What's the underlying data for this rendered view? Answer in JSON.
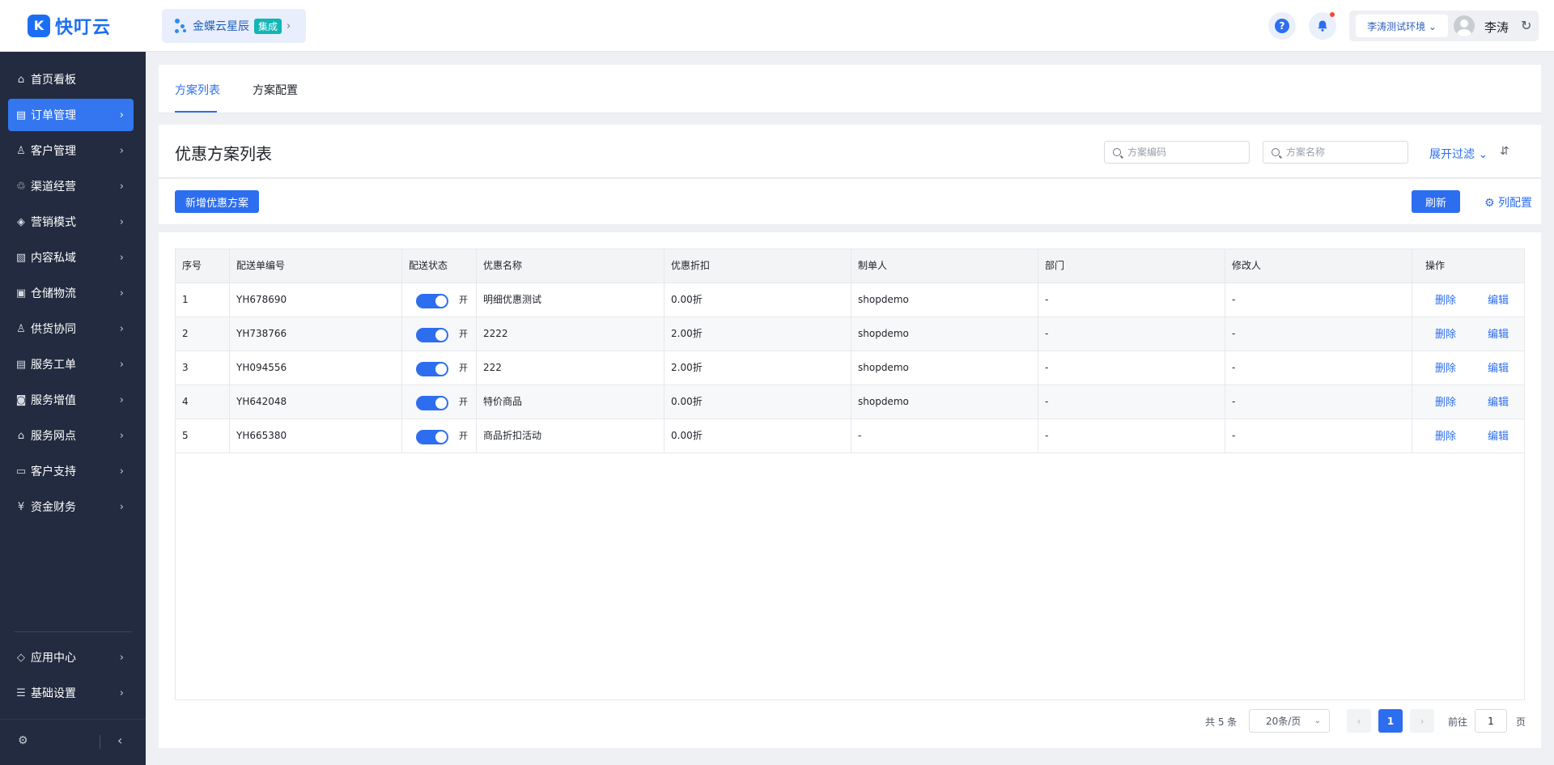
{
  "brand": {
    "logo_text": "快叮云",
    "logo_mark": "K"
  },
  "integration": {
    "label": "金蝶云星辰",
    "tag": "集成",
    "arrow": "›"
  },
  "topbar": {
    "help_icon": "question-circle-icon",
    "bell_icon": "bell-icon",
    "environment": "李涛测试环境 ⌄",
    "user_name": "李涛",
    "refresh_glyph": "↻"
  },
  "sidebar": {
    "items": [
      {
        "label": "首页看板",
        "icon": "⌂",
        "chevron": ""
      },
      {
        "label": "订单管理",
        "icon": "▤",
        "chevron": "›"
      },
      {
        "label": "客户管理",
        "icon": "♙",
        "chevron": "›"
      },
      {
        "label": "渠道经营",
        "icon": "♲",
        "chevron": "›"
      },
      {
        "label": "营销模式",
        "icon": "◈",
        "chevron": "›"
      },
      {
        "label": "内容私域",
        "icon": "▧",
        "chevron": "›"
      },
      {
        "label": "仓储物流",
        "icon": "▣",
        "chevron": "›"
      },
      {
        "label": "供货协同",
        "icon": "♙",
        "chevron": "›"
      },
      {
        "label": "服务工单",
        "icon": "▤",
        "chevron": "›"
      },
      {
        "label": "服务增值",
        "icon": "◙",
        "chevron": "›"
      },
      {
        "label": "服务网点",
        "icon": "⌂",
        "chevron": "›"
      },
      {
        "label": "客户支持",
        "icon": "▭",
        "chevron": "›"
      },
      {
        "label": "资金财务",
        "icon": "¥",
        "chevron": "›"
      }
    ],
    "bottom_items": [
      {
        "label": "应用中心",
        "icon": "◇",
        "chevron": "›"
      },
      {
        "label": "基础设置",
        "icon": "☰",
        "chevron": "›"
      }
    ],
    "active_index": 1,
    "footer": {
      "gear_glyph": "⚙",
      "collapse_glyph": "‹"
    }
  },
  "tabs": [
    {
      "label": "方案列表"
    },
    {
      "label": "方案配置"
    }
  ],
  "header": {
    "title": "优惠方案列表",
    "search1_placeholder": "方案编码",
    "search2_placeholder": "方案名称",
    "expand_filter": "展开过滤 ⌄",
    "sort_glyph": "⇵"
  },
  "actions": {
    "add_button": "新增优惠方案",
    "refresh_button": "刷新",
    "column_config": "⚙ 列配置"
  },
  "table": {
    "columns": [
      "序号",
      "配送单编号",
      "配送状态",
      "优惠名称",
      "优惠折扣",
      "制单人",
      "部门",
      "修改人",
      "操作"
    ],
    "rows": [
      {
        "index": "1",
        "code": "YH678690",
        "status_on": true,
        "status_label": "开",
        "name": "明细优惠测试",
        "discount": "0.00折",
        "creator": "shopdemo",
        "dept": "-",
        "modifier": "-"
      },
      {
        "index": "2",
        "code": "YH738766",
        "status_on": true,
        "status_label": "开",
        "name": "2222",
        "discount": "2.00折",
        "creator": "shopdemo",
        "dept": "-",
        "modifier": "-"
      },
      {
        "index": "3",
        "code": "YH094556",
        "status_on": true,
        "status_label": "开",
        "name": "222",
        "discount": "2.00折",
        "creator": "shopdemo",
        "dept": "-",
        "modifier": "-"
      },
      {
        "index": "4",
        "code": "YH642048",
        "status_on": true,
        "status_label": "开",
        "name": "特价商品",
        "discount": "0.00折",
        "creator": "shopdemo",
        "dept": "-",
        "modifier": "-"
      },
      {
        "index": "5",
        "code": "YH665380",
        "status_on": true,
        "status_label": "开",
        "name": "商品折扣活动",
        "discount": "0.00折",
        "creator": "-",
        "dept": "-",
        "modifier": "-"
      }
    ],
    "row_actions": {
      "delete": "删除",
      "edit": "编辑"
    }
  },
  "pagination": {
    "total": "共 5 条",
    "page_size": "20条/页",
    "page_size_arrow": "⌄",
    "prev_glyph": "‹",
    "next_glyph": "›",
    "current_page": "1",
    "goto_prefix": "前往",
    "goto_value": "1",
    "goto_suffix": "页"
  },
  "colors": {
    "primary": "#2d6ef0",
    "sidebar_bg": "#222b3f",
    "sidebar_active": "#3476f0",
    "brand": "#1b6ef3",
    "integration_tag": "#11b6b6",
    "notification_dot": "#f04b30"
  }
}
